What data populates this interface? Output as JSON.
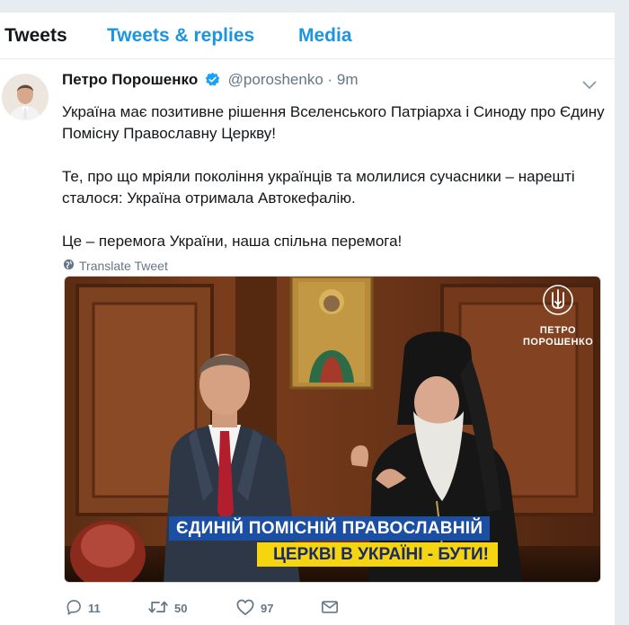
{
  "tabs": [
    {
      "label": "Tweets"
    },
    {
      "label": "Tweets & replies"
    },
    {
      "label": "Media"
    }
  ],
  "tweet": {
    "author_name": "Петро Порошенко",
    "handle": "@poroshenko",
    "separator": " · ",
    "time": "9m",
    "paragraphs": [
      "Україна має позитивне рішення Вселенського Патріарха і Синоду про Єдину Помісну Православну Церкву!",
      "Те, про що мріяли покоління українців та молилися сучасники – нарешті сталося: Україна отримала Автокефалію.",
      "Це – перемога України, наша спільна перемога!"
    ],
    "translate_label": "Translate Tweet",
    "media": {
      "brand_line1": "ПЕТРО",
      "brand_line2": "ПОРОШЕНКО",
      "banner_line1": "ЄДИНІЙ ПОМІСНІЙ ПРАВОСЛАВНІЙ",
      "banner_line2": "ЦЕРКВІ В УКРАЇНІ - БУТИ!"
    },
    "actions": {
      "replies": "11",
      "retweets": "50",
      "likes": "97"
    }
  },
  "colors": {
    "accent": "#1b95e0",
    "muted": "#657786",
    "banner_blue": "#1a4fa3",
    "banner_yellow": "#f5d410"
  },
  "icons": [
    "verified-badge-icon",
    "chevron-down-icon",
    "globe-icon",
    "trident-logo",
    "reply-icon",
    "retweet-icon",
    "heart-icon",
    "envelope-icon"
  ]
}
